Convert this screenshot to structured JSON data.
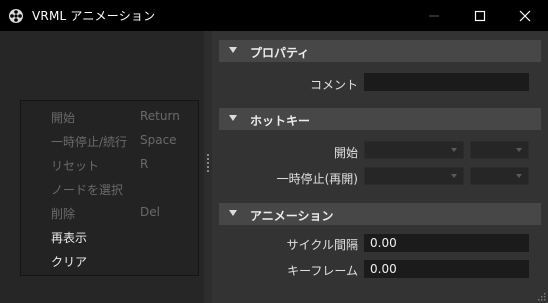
{
  "window": {
    "title": "VRML アニメーション",
    "app_icon": "film-reel-icon",
    "controls": [
      "minimize-icon",
      "maximize-icon",
      "close-icon"
    ]
  },
  "commands": [
    {
      "label": "開始",
      "shortcut": "Return",
      "enabled": false
    },
    {
      "label": "一時停止/続行",
      "shortcut": "Space",
      "enabled": false
    },
    {
      "label": "リセット",
      "shortcut": "R",
      "enabled": false
    },
    {
      "label": "ノードを選択",
      "shortcut": "",
      "enabled": false
    },
    {
      "label": "削除",
      "shortcut": "Del",
      "enabled": false
    },
    {
      "label": "再表示",
      "shortcut": "",
      "enabled": true
    },
    {
      "label": "クリア",
      "shortcut": "",
      "enabled": true
    }
  ],
  "properties": {
    "header": "プロパティ",
    "comment_label": "コメント",
    "comment_value": ""
  },
  "hotkeys": {
    "header": "ホットキー",
    "start_label": "開始",
    "pause_label": "一時停止(再開)"
  },
  "animation": {
    "header": "アニメーション",
    "cycle_interval_label": "サイクル間隔",
    "cycle_interval_value": "0.00",
    "keyframe_label": "キーフレーム",
    "keyframe_value": "0.00"
  },
  "colors": {
    "titlebar": "#000000",
    "section_header": "#474747",
    "disabled_text": "#6a6a6a"
  }
}
